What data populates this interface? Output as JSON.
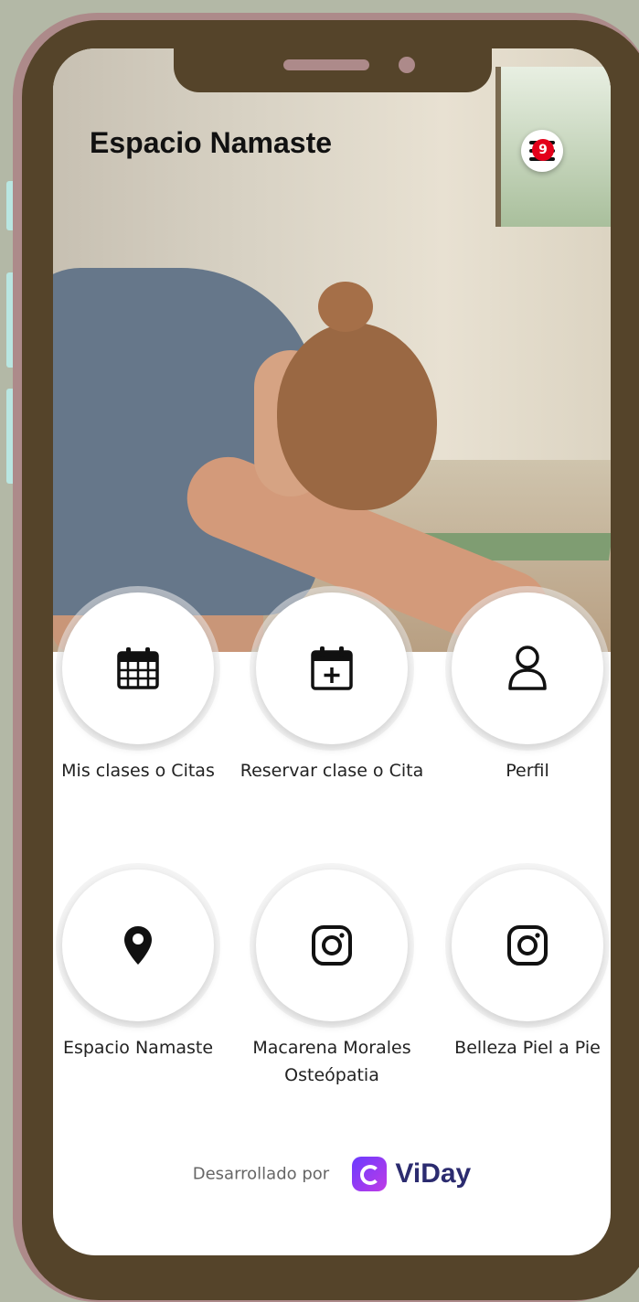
{
  "app": {
    "title": "Espacio Namaste",
    "notifications_count": "9"
  },
  "tiles": [
    {
      "label": "Mis clases o Citas",
      "icon": "calendar-icon"
    },
    {
      "label": "Reservar clase o Cita",
      "icon": "calendar-add-icon"
    },
    {
      "label": "Perfil",
      "icon": "user-icon"
    },
    {
      "label": "Espacio Namaste",
      "icon": "location-pin-icon"
    },
    {
      "label": "Macarena Morales Osteópatia",
      "icon": "instagram-icon"
    },
    {
      "label": "Belleza Piel a Pie",
      "icon": "instagram-icon"
    }
  ],
  "footer": {
    "developed_by": "Desarrollado por",
    "brand": "ViDay",
    "brand_color": "#2b2b6f"
  },
  "colors": {
    "frame": "#55442a",
    "frame_outer": "#ad8a8a",
    "background": "#b3b8a6",
    "badge": "#e3001a"
  }
}
